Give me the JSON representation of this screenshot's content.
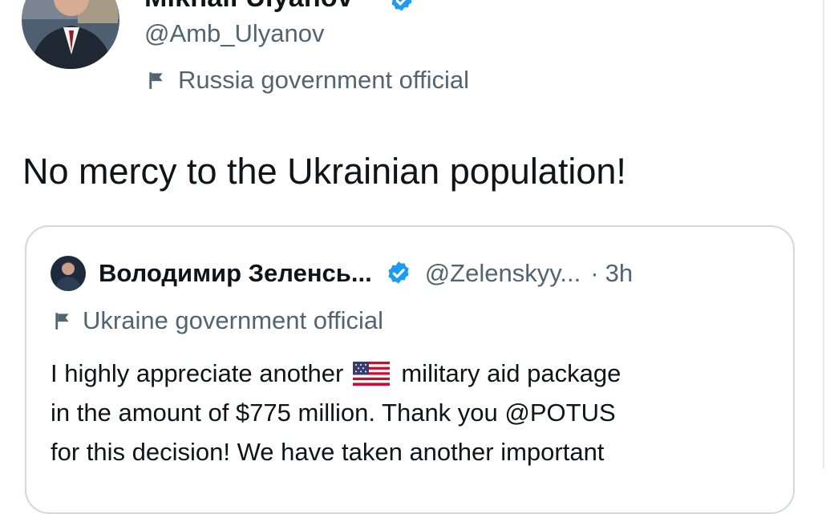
{
  "tweet": {
    "author": {
      "name": "Mikhail Ulyanov",
      "handle": "@Amb_Ulyanov",
      "label": "Russia government official"
    },
    "text": "No mercy to the Ukrainian population!",
    "quoted_tweet": {
      "author": {
        "name": "Володимир Зеленсь...",
        "handle": "@Zelenskyy...",
        "time_separator": "·",
        "time": "3h",
        "label": "Ukraine government official"
      },
      "body": {
        "line1_before": "I highly appreciate another",
        "line1_after": "military aid package",
        "line2": "in the amount of $775 million. Thank you @POTUS",
        "line3": "for this decision! We have taken another important"
      }
    }
  },
  "icons": {
    "verified": "verified-badge-icon",
    "flag": "government-label-flag-icon",
    "us_flag": "us-flag-emoji-icon"
  },
  "colors": {
    "primary_text": "#0f1419",
    "secondary_text": "#536471",
    "verified_blue": "#1d9bf0",
    "card_border": "#cfd9de"
  }
}
